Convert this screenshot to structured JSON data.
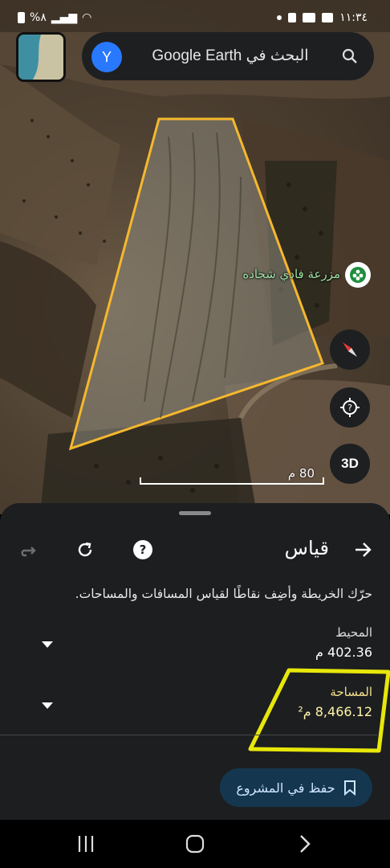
{
  "status_bar": {
    "battery": "%٨",
    "time": "١١:٣٤"
  },
  "search": {
    "avatar_letter": "Y",
    "placeholder": "البحث في Google Earth",
    "icon": "search-icon"
  },
  "map": {
    "place_name": "مزرعة فادي شحاده",
    "scale_label": "80 م",
    "button_3d": "3D",
    "icons": [
      "compass-icon",
      "location-icon",
      "place-pin-icon"
    ],
    "polygon_color": "#f5b82e",
    "highlight_color": "#f2f20a"
  },
  "measure": {
    "title": "قياس",
    "instructions": "حرّك الخريطة وأضِف نقاطًا لقياس المسافات والمساحات.",
    "perimeter_label": "المحيط",
    "perimeter_value": "402.36 م",
    "area_label": "المساحة",
    "area_value": "8,466.12 م²",
    "save_label": "حفظ في المشروع",
    "icons": [
      "back-arrow-icon",
      "help-icon",
      "reset-icon",
      "redo-icon",
      "bookmark-icon",
      "chevron-down-icon"
    ]
  },
  "navbar": {
    "icons": [
      "recents-icon",
      "home-icon",
      "back-icon"
    ]
  }
}
